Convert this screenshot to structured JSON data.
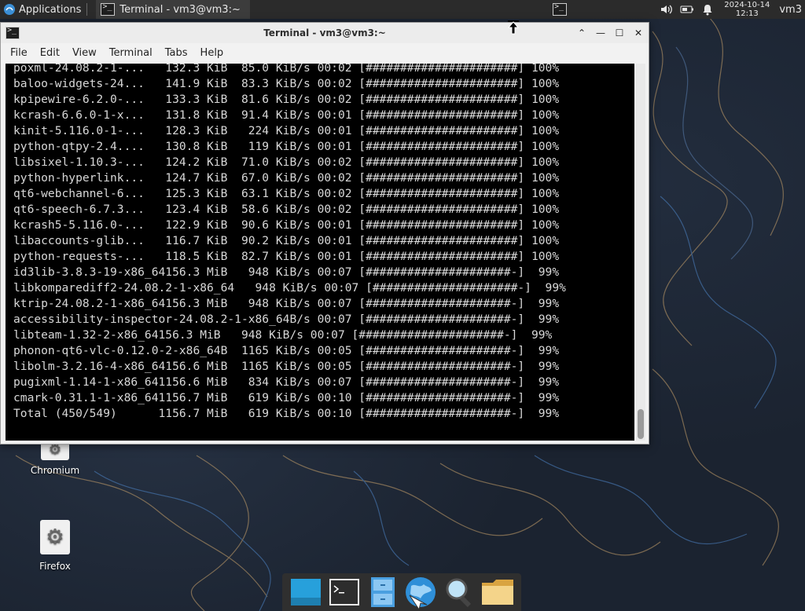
{
  "panel": {
    "applications_label": "Applications",
    "task_title": "Terminal - vm3@vm3:~",
    "clock_date": "2024-10-14",
    "clock_time": "12:13",
    "user": "vm3"
  },
  "window": {
    "title": "Terminal - vm3@vm3:~",
    "menu": [
      "File",
      "Edit",
      "View",
      "Terminal",
      "Tabs",
      "Help"
    ]
  },
  "terminal": {
    "lines": [
      "poxml-24.08.2-1-...   132.3 KiB  85.0 KiB/s 00:02 [######################] 100%",
      "baloo-widgets-24...   141.9 KiB  83.3 KiB/s 00:02 [######################] 100%",
      "kpipewire-6.2.0-...   133.3 KiB  81.6 KiB/s 00:02 [######################] 100%",
      "kcrash-6.6.0-1-x...   131.8 KiB  91.4 KiB/s 00:01 [######################] 100%",
      "kinit-5.116.0-1-...   128.3 KiB   224 KiB/s 00:01 [######################] 100%",
      "python-qtpy-2.4....   130.8 KiB   119 KiB/s 00:01 [######################] 100%",
      "libsixel-1.10.3-...   124.2 KiB  71.0 KiB/s 00:02 [######################] 100%",
      "python-hyperlink...   124.7 KiB  67.0 KiB/s 00:02 [######################] 100%",
      "qt6-webchannel-6...   125.3 KiB  63.1 KiB/s 00:02 [######################] 100%",
      "qt6-speech-6.7.3...   123.4 KiB  58.6 KiB/s 00:02 [######################] 100%",
      "kcrash5-5.116.0-...   122.9 KiB  90.6 KiB/s 00:01 [######################] 100%",
      "libaccounts-glib...   116.7 KiB  90.2 KiB/s 00:01 [######################] 100%",
      "python-requests-...   118.5 KiB  82.7 KiB/s 00:01 [######################] 100%",
      "id3lib-3.8.3-19-x86_64156.3 MiB   948 KiB/s 00:07 [#####################-]  99%",
      "libkomparediff2-24.08.2-1-x86_64   948 KiB/s 00:07 [#####################-]  99%",
      "ktrip-24.08.2-1-x86_64156.3 MiB   948 KiB/s 00:07 [#####################-]  99%",
      "accessibility-inspector-24.08.2-1-x86_64B/s 00:07 [#####################-]  99%",
      "libteam-1.32-2-x86_64156.3 MiB   948 KiB/s 00:07 [#####################-]  99%",
      "phonon-qt6-vlc-0.12.0-2-x86_64B  1165 KiB/s 00:05 [#####################-]  99%",
      "libolm-3.2.16-4-x86_64156.6 MiB  1165 KiB/s 00:05 [#####################-]  99%",
      "pugixml-1.14-1-x86_641156.6 MiB   834 KiB/s 00:07 [#####################-]  99%",
      "cmark-0.31.1-1-x86_641156.7 MiB   619 KiB/s 00:10 [#####################-]  99%",
      "Total (450/549)      1156.7 MiB   619 KiB/s 00:10 [#####################-]  99%"
    ]
  },
  "desktop": {
    "icons": [
      {
        "label": "Chromium",
        "icon": "gear-icon"
      },
      {
        "label": "Firefox",
        "icon": "gear-icon"
      }
    ]
  },
  "dock": {
    "items": [
      "show-desktop-icon",
      "terminal-icon",
      "file-manager-icon",
      "web-browser-icon",
      "search-icon",
      "folder-icon"
    ]
  },
  "colors": {
    "panel_bg": "#2b2b2b",
    "terminal_bg": "#000000",
    "terminal_fg": "#d8d8d8",
    "dock_bg": "#2f2f2f"
  }
}
